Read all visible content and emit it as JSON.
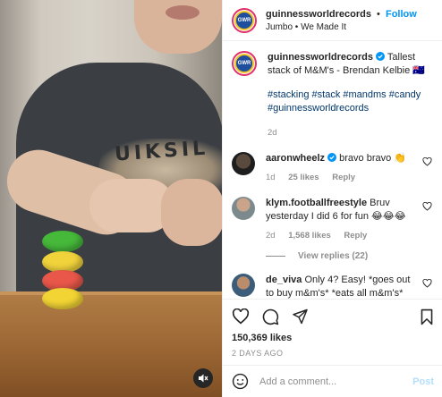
{
  "header": {
    "username": "guinnessworldrecords",
    "separator": "•",
    "follow_label": "Follow",
    "subline": "Jumbo • We Made It",
    "avatar_text": "GWR"
  },
  "caption": {
    "username": "guinnessworldrecords",
    "text": "Tallest stack of M&M's - Brendan Kelbie 🇦🇺",
    "hashtags": "#stacking #stack #mandms #candy #guinnessworldrecords",
    "time": "2d"
  },
  "comments": [
    {
      "username": "aaronwheelz",
      "text": "bravo bravo 👏",
      "time": "1d",
      "likes": "25 likes",
      "reply_label": "Reply"
    },
    {
      "username": "klym.footballfreestyle",
      "text": "Bruv yesterday I did 6 for fun 😂😂😂",
      "time": "2d",
      "likes": "1,568 likes",
      "reply_label": "Reply",
      "view_replies": "View replies (22)"
    },
    {
      "username": "de_viva",
      "text": "Only 4? Easy! *goes out to buy m&m's* *eats all m&m's*",
      "time": "",
      "likes": "",
      "reply_label": ""
    }
  ],
  "post": {
    "likes": "150,369 likes",
    "time_ago": "2 DAYS AGO"
  },
  "add_comment": {
    "placeholder": "Add a comment...",
    "post_label": "Post"
  },
  "media": {
    "shirt_text": "UIKSIL",
    "mm_colors": [
      "#46b83a",
      "#f0d23b",
      "#e8574a",
      "#f2d434"
    ]
  },
  "colors": {
    "accent": "#0095f6",
    "verified": "#0095f6",
    "hashtag": "#00376b",
    "muted": "#8e8e8e"
  }
}
